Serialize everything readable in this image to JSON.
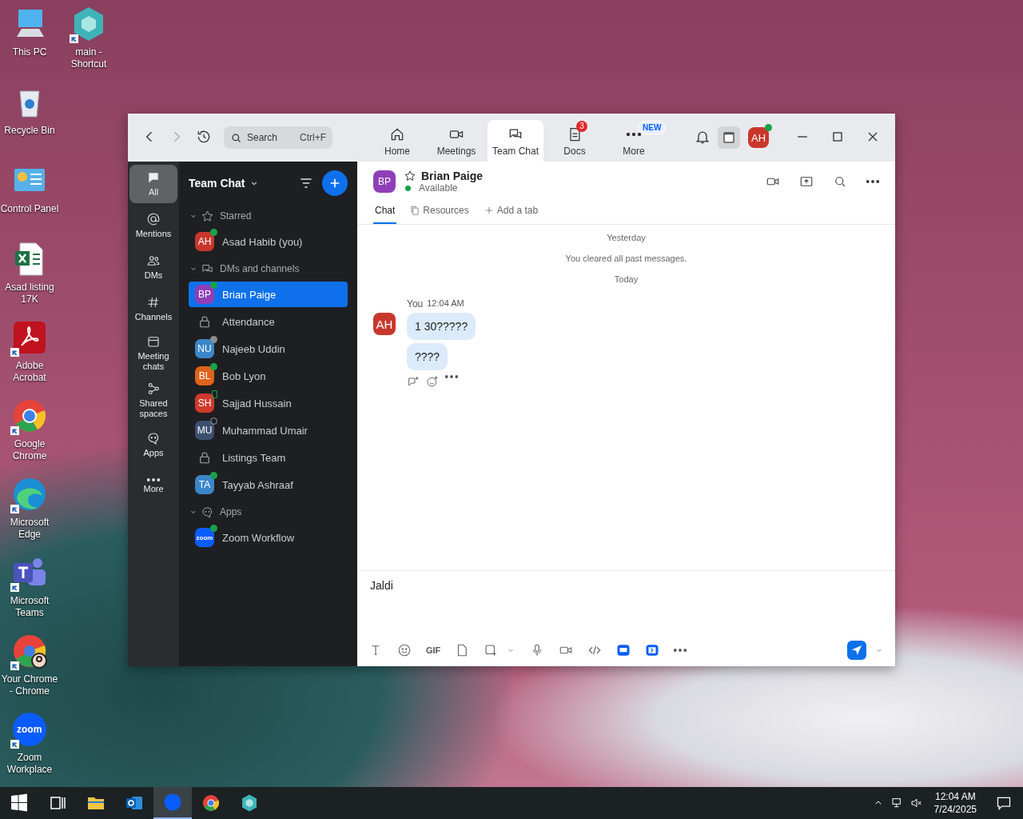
{
  "desktop": {
    "icons": [
      {
        "label": "This PC",
        "kind": "pc",
        "shortcut": false
      },
      {
        "label": "main - Shortcut",
        "kind": "hexagon",
        "shortcut": true
      },
      {
        "label": "Recycle Bin",
        "kind": "recycle",
        "shortcut": false
      },
      {
        "label": "Control Panel",
        "kind": "control",
        "shortcut": false
      },
      {
        "label": "Asad listing 17K",
        "kind": "excel",
        "shortcut": false
      },
      {
        "label": "Adobe Acrobat",
        "kind": "acrobat",
        "shortcut": true
      },
      {
        "label": "Google Chrome",
        "kind": "chrome",
        "shortcut": true
      },
      {
        "label": "Microsoft Edge",
        "kind": "edge",
        "shortcut": true
      },
      {
        "label": "Microsoft Teams",
        "kind": "teams",
        "shortcut": true
      },
      {
        "label": "Your Chrome - Chrome",
        "kind": "chrome-profile",
        "shortcut": true
      },
      {
        "label": "Zoom Workplace",
        "kind": "zoom",
        "shortcut": true
      }
    ]
  },
  "window": {
    "search": {
      "placeholder": "Search",
      "shortcut": "Ctrl+F"
    },
    "nav": [
      {
        "label": "Home",
        "kind": "home",
        "selected": false
      },
      {
        "label": "Meetings",
        "kind": "meetings",
        "selected": false
      },
      {
        "label": "Team Chat",
        "kind": "chat",
        "selected": true
      },
      {
        "label": "Docs",
        "kind": "docs",
        "selected": false,
        "badge": "3"
      },
      {
        "label": "More",
        "kind": "more",
        "selected": false,
        "badge": "NEW"
      }
    ],
    "account": {
      "initials": "AH",
      "color": "#c9372c",
      "status": {
        "kind": "online"
      }
    },
    "rail": [
      {
        "label": "All",
        "kind": "bubble-fill",
        "selected": true
      },
      {
        "label": "Mentions",
        "kind": "at",
        "selected": false
      },
      {
        "label": "DMs",
        "kind": "people",
        "selected": false
      },
      {
        "label": "Channels",
        "kind": "hash",
        "selected": false
      },
      {
        "label": "Meeting chats",
        "kind": "calendar",
        "selected": false
      },
      {
        "label": "Shared spaces",
        "kind": "nodes",
        "selected": false
      },
      {
        "label": "Apps",
        "kind": "bubble",
        "selected": false
      },
      {
        "label": "More",
        "kind": "more",
        "selected": false
      }
    ],
    "list": {
      "title": "Team Chat",
      "sections": [
        {
          "title": "Starred",
          "kind": "star",
          "expanded": true,
          "items": [
            {
              "kind": "person",
              "name": "Asad Habib (you)",
              "initials": "AH",
              "color": "#c9372c",
              "status": {
                "kind": "online"
              },
              "selected": false
            }
          ]
        },
        {
          "title": "DMs and channels",
          "kind": "chat",
          "expanded": true,
          "items": [
            {
              "kind": "person",
              "name": "Brian Paige",
              "initials": "BP",
              "color": "#8e3fb8",
              "status": {
                "kind": "online"
              },
              "selected": true
            },
            {
              "kind": "channel",
              "name": "Attendance",
              "selected": false
            },
            {
              "kind": "person",
              "name": "Najeeb Uddin",
              "initials": "NU",
              "color": "#3a86c8",
              "status": {
                "kind": "offline"
              },
              "selected": false
            },
            {
              "kind": "person",
              "name": "Bob Lyon",
              "initials": "BL",
              "color": "#e0621b",
              "status": {
                "kind": "online"
              },
              "selected": false
            },
            {
              "kind": "person",
              "name": "Sajjad Hussain",
              "initials": "SH",
              "color": "#d0392b",
              "status": {
                "kind": "mobile"
              },
              "selected": false
            },
            {
              "kind": "person",
              "name": "Muhammad Umair",
              "initials": "MU",
              "color": "#3c4f6e",
              "status": {
                "kind": "away"
              },
              "selected": false
            },
            {
              "kind": "channel",
              "name": "Listings Team",
              "selected": false
            },
            {
              "kind": "person",
              "name": "Tayyab Ashraaf",
              "initials": "TA",
              "color": "#3a86c8",
              "status": {
                "kind": "online"
              },
              "selected": false
            }
          ]
        },
        {
          "title": "Apps",
          "kind": "bubble",
          "expanded": true,
          "items": [
            {
              "kind": "app",
              "name": "Zoom Workflow",
              "initials": "zoom",
              "color": "#0b5cff",
              "status": {
                "kind": "online"
              },
              "selected": false
            }
          ]
        }
      ]
    },
    "chat": {
      "contact": {
        "initials": "BP",
        "color": "#8e3fb8",
        "name": "Brian Paige",
        "status_text": "Available",
        "status": {
          "kind": "online"
        }
      },
      "tabs": [
        {
          "label": "Chat",
          "kind": "none",
          "selected": true
        },
        {
          "label": "Resources",
          "kind": "resources",
          "selected": false
        },
        {
          "label": "Add a tab",
          "kind": "plus",
          "selected": false
        }
      ],
      "timeline": [
        {
          "kind": "date",
          "text": "Yesterday"
        },
        {
          "kind": "system",
          "text": "You cleared all past messages."
        },
        {
          "kind": "date",
          "text": "Today"
        },
        {
          "kind": "message",
          "sender": "You",
          "time": "12:04 AM",
          "initials": "AH",
          "color": "#c9372c",
          "bubbles": [
            "1 30?????",
            "????"
          ]
        }
      ],
      "composer": {
        "value": "Jaldi",
        "tools": [
          {
            "kind": "format"
          },
          {
            "kind": "emoji"
          },
          {
            "kind": "gif",
            "label": "GIF"
          },
          {
            "kind": "file"
          },
          {
            "kind": "screenshot"
          },
          {
            "kind": "chevron"
          },
          {
            "kind": "mic"
          },
          {
            "kind": "video"
          },
          {
            "kind": "code"
          },
          {
            "kind": "whiteboard"
          },
          {
            "kind": "clips"
          },
          {
            "kind": "more"
          }
        ]
      }
    }
  },
  "taskbar": {
    "apps": [
      {
        "kind": "start",
        "selected": false
      },
      {
        "kind": "taskview",
        "selected": false
      },
      {
        "kind": "folder",
        "selected": false
      },
      {
        "kind": "outlook",
        "selected": false
      },
      {
        "kind": "zoom",
        "selected": true
      },
      {
        "kind": "chrome",
        "selected": false
      },
      {
        "kind": "hexagon",
        "selected": false
      }
    ],
    "time": "12:04 AM",
    "date": "7/24/2025"
  }
}
